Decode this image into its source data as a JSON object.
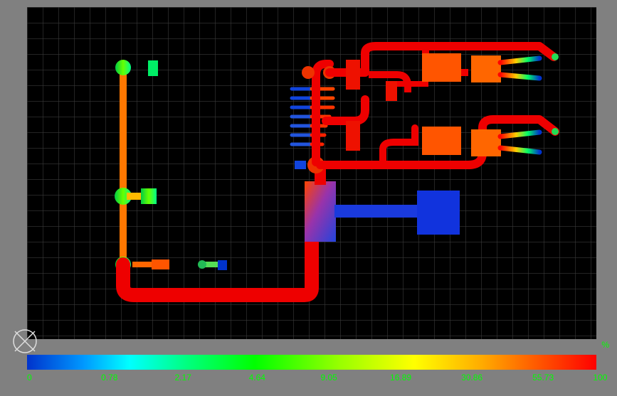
{
  "colorbar": {
    "ticks": [
      {
        "value": "0",
        "position": 0
      },
      {
        "value": "0.78",
        "position": 12.7
      },
      {
        "value": "2.17",
        "position": 25.3
      },
      {
        "value": "4.64",
        "position": 38.0
      },
      {
        "value": "9.05",
        "position": 50.3
      },
      {
        "value": "16.89",
        "position": 62.2
      },
      {
        "value": "30.86",
        "position": 74.4
      },
      {
        "value": "55.73",
        "position": 86.6
      },
      {
        "value": "100",
        "position": 99.0
      }
    ],
    "unit": "%"
  },
  "chart_data": {
    "type": "heatmap",
    "title": "Current density / thermal map on PCB trace layout",
    "colorbar_unit": "percent",
    "colorbar_scale": "logarithmic",
    "colorbar_stops": [
      0,
      0.78,
      2.17,
      4.64,
      9.05,
      16.89,
      30.86,
      55.73,
      100
    ],
    "grid_spacing_px": 22,
    "observations": [
      "Left vertical orange trace ~30-55% intensity with two green nodes ~5-16%",
      "Lower horizontal main red bus ~100% intensity",
      "Right-side branching network mostly red ~55-100% with orange pads ~30-55%",
      "Two upper-right output pairs transition red→green→blue (high→low)",
      "Lower-right large blue block ~0-1% (cold/low density)",
      "Central purple/blue gradient block transitions from red to blue",
      "Left edge of center bus has short blue stubs ~0-1%",
      "Small scattered green/yellow pads ~9-30% at lower-left"
    ]
  }
}
